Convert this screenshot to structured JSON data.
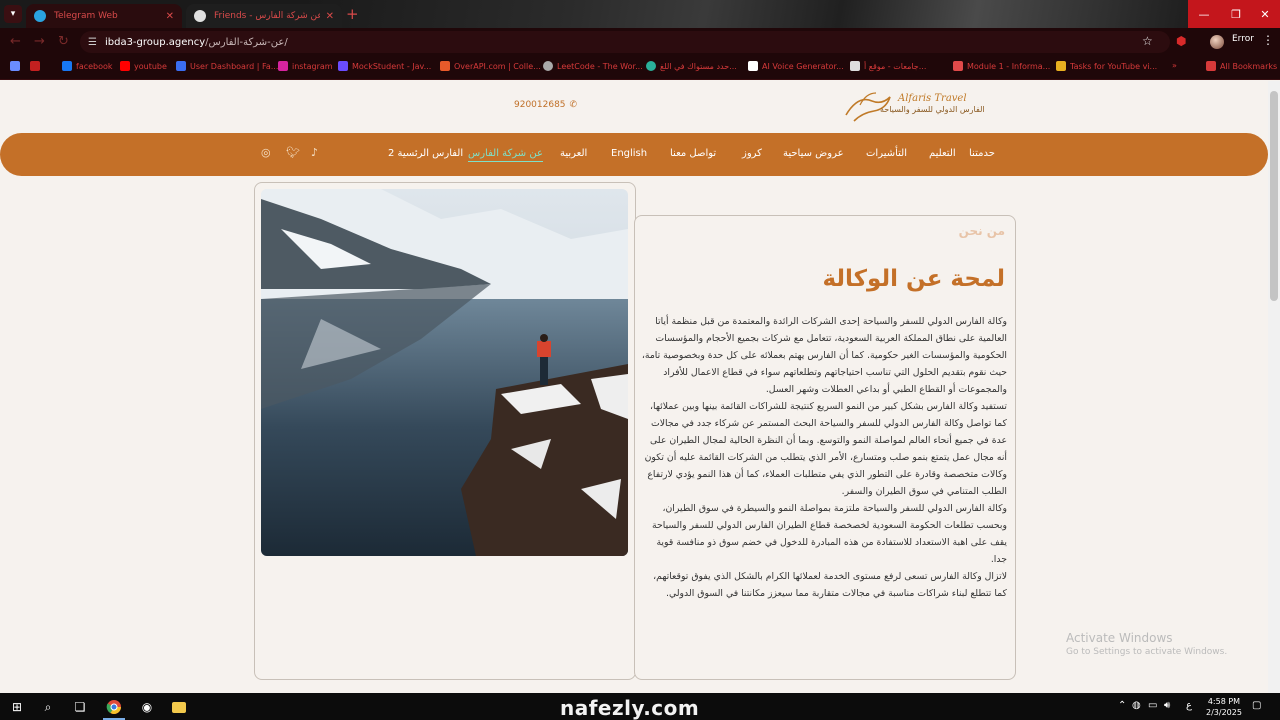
{
  "browser": {
    "tabs": [
      {
        "label": "Telegram Web",
        "color": "#2aa3e0"
      },
      {
        "label": "Friends - عن شركة الفارس",
        "color": "#e04a4a"
      }
    ],
    "url_host": "ibda3-group.agency",
    "url_path": "/عن-شركة-الفارس/",
    "error_label": "Error",
    "bookmarks": [
      {
        "label": "facebook",
        "color": "#1877f2"
      },
      {
        "label": "youtube",
        "color": "#ff0000"
      },
      {
        "label": "User Dashboard | Fa...",
        "color": "#3a6df0"
      },
      {
        "label": "instagram",
        "color": "#d6249f"
      },
      {
        "label": "MockStudent - Jav...",
        "color": "#6a4cff"
      },
      {
        "label": "OverAPI.com | Colle...",
        "color": "#e85a2a"
      },
      {
        "label": "LeetCode - The Wor...",
        "color": "#aaaaaa"
      },
      {
        "label": "حدد مستواك في اللغ...",
        "color": "#2ab09a"
      },
      {
        "label": "AI Voice Generator...",
        "color": "#ffffff"
      },
      {
        "label": "جامعات - موقع أ...",
        "color": "#dddddd"
      },
      {
        "label": "Module 1 - Informa...",
        "color": "#e04a4a"
      },
      {
        "label": "Tasks for YouTube vi...",
        "color": "#e8b020"
      }
    ],
    "all_bookmarks": "All Bookmarks"
  },
  "site": {
    "phone": "920012685",
    "logo_en": "Alfaris Travel",
    "logo_ar": "الفارس الدولي للسفر والسياحة",
    "nav": [
      "حدمتنا",
      "التعليم",
      "التأشيرات",
      "عروض سياحية",
      "كروز",
      "تواصل معنا",
      "English",
      "العربية",
      "عن شركة الفارس",
      "الفارس الرئسية 2"
    ],
    "eyebrow": "من نحن",
    "heading": "لمحة عن الوكالة",
    "paragraphs": [
      "وكالة الفارس الدولي للسفر والسياحة إحدى الشركات الرائدة والمعتمدة من قبل منظمة أياتا العالمية على نطاق المملكة العربية السعودية، تتعامل مع شركات بجميع الأحجام والمؤسسات الحكومية والمؤسسات الغير حكومية. كما أن الفارس يهتم بعملائه على كل حدة وبخصوصية تامة، حيث نقوم بتقديم الحلول التي تناسب احتياجاتهم وتطلعاتهم سواء في قطاع الاعمال للأفراد والمجموعات أو القطاع الطبي أو بداعي العطلات وشهر العسل.",
      "تستفيد وكالة الفارس بشكل كبير من النمو السريع كنتيجة للشراكات القائمة بينها وبين عملائها، كما تواصل وكالة الفارس الدولي للسفر والسياحة البحث المستمر عن شركاء جدد في مجالات عدة في جميع أنحاء العالم لمواصلة النمو والتوسع. وبما أن النظرة الحالية لمجال الطيران على أنه مجال عمل يتمتع بنمو صلب ومتسارع، الأمر الذي يتطلب من الشركات القائمة عليه أن تكون وكالات متخصصة وقادرة على التطور الذي يفي متطلبات العملاء، كما أن هذا النمو يؤدي لارتفاع الطلب المتنامي في سوق الطيران والسفر.",
      "وكالة الفارس الدولي للسفر والسياحة ملتزمة بمواصلة النمو والسيطرة في سوق الطيران، وبحسب تطلعات الحكومة السعودية لخصخصة قطاع الطيران الفارس الدولي للسفر والسياحة يقف على اهبة الاستعداد للاستفادة من هذه المبادرة للدخول في خضم سوق ذو منافسة قوية جدا.",
      "لاتزال وكالة الفارس تسعى لرفع مستوى الخدمة لعملائها الكرام بالشكل الذي يفوق توقعاتهم، كما تتطلع لبناء شراكات مناسبة في مجالات متقاربة مما سيعزز مكانتنا في السوق الدولي."
    ],
    "watermark_title": "Activate Windows",
    "watermark_sub": "Go to Settings to activate Windows."
  },
  "taskbar": {
    "center_text": "nafezly.com",
    "lang": "ع",
    "time": "4:58 PM",
    "date": "2/3/2025"
  }
}
